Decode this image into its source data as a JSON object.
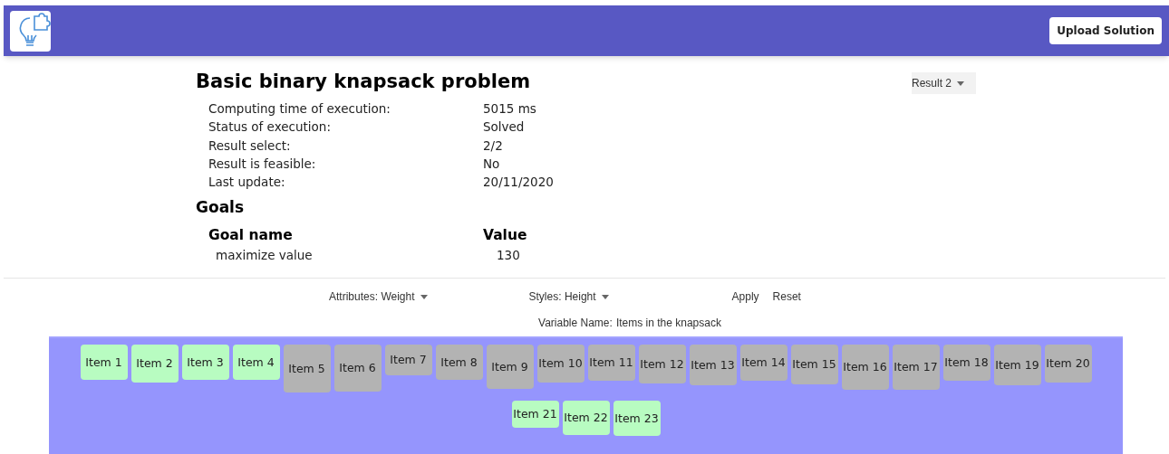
{
  "header": {
    "upload_button": "Upload Solution"
  },
  "result_dropdown": "Result 2",
  "title": "Basic binary knapsack problem",
  "details": [
    {
      "label": "Computing time of execution:",
      "value": "5015 ms"
    },
    {
      "label": "Status of execution:",
      "value": "Solved"
    },
    {
      "label": "Result select:",
      "value": "2/2"
    },
    {
      "label": "Result is feasible:",
      "value": "No"
    },
    {
      "label": "Last update:",
      "value": "20/11/2020"
    }
  ],
  "goals": {
    "heading": "Goals",
    "columns": [
      "Goal name",
      "Value"
    ],
    "rows": [
      {
        "name": "maximize value",
        "value": "130"
      }
    ]
  },
  "controls": {
    "attributes": {
      "label": "Attributes:",
      "value": "Weight"
    },
    "styles": {
      "label": "Styles:",
      "value": "Height"
    },
    "apply": "Apply",
    "reset": "Reset"
  },
  "variable": {
    "label": "Variable Name:",
    "value": "Items in the knapsack"
  },
  "items": [
    {
      "label": "Item 1",
      "selected": true
    },
    {
      "label": "Item 2",
      "selected": true
    },
    {
      "label": "Item 3",
      "selected": true
    },
    {
      "label": "Item 4",
      "selected": true
    },
    {
      "label": "Item 5",
      "selected": false
    },
    {
      "label": "Item 6",
      "selected": false
    },
    {
      "label": "Item 7",
      "selected": false
    },
    {
      "label": "Item 8",
      "selected": false
    },
    {
      "label": "Item 9",
      "selected": false
    },
    {
      "label": "Item 10",
      "selected": false
    },
    {
      "label": "Item 11",
      "selected": false
    },
    {
      "label": "Item 12",
      "selected": false
    },
    {
      "label": "Item 13",
      "selected": false
    },
    {
      "label": "Item 14",
      "selected": false
    },
    {
      "label": "Item 15",
      "selected": false
    },
    {
      "label": "Item 16",
      "selected": false
    },
    {
      "label": "Item 17",
      "selected": false
    },
    {
      "label": "Item 18",
      "selected": false
    },
    {
      "label": "Item 19",
      "selected": false
    },
    {
      "label": "Item 20",
      "selected": false
    },
    {
      "label": "Item 21",
      "selected": true
    },
    {
      "label": "Item 22",
      "selected": true
    },
    {
      "label": "Item 23",
      "selected": true
    }
  ]
}
